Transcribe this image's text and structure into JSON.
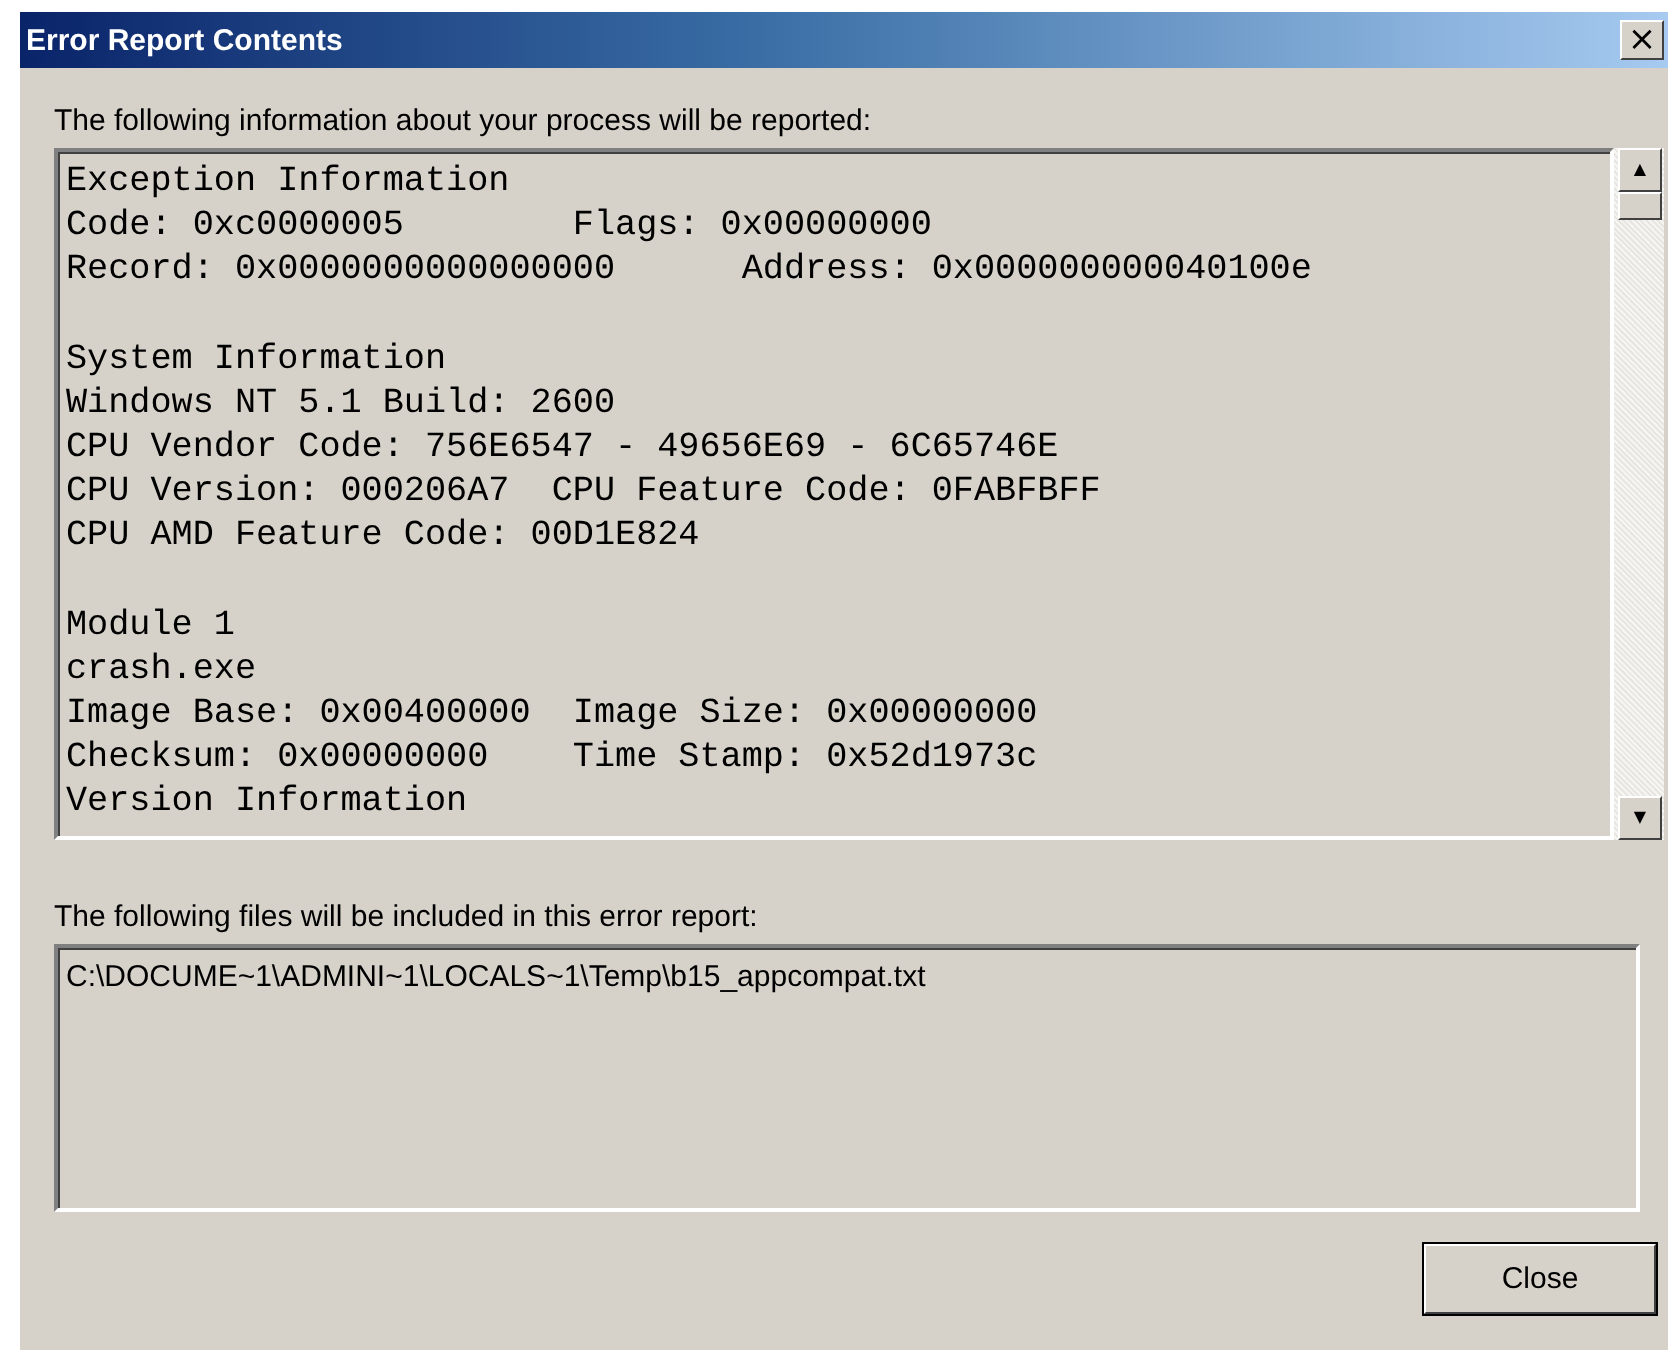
{
  "window": {
    "title": "Error Report Contents",
    "close": "×"
  },
  "report": {
    "label": "The following information about your process will be reported:",
    "sections": [
      {
        "lines": [
          "Exception Information",
          "Code: 0xc0000005        Flags: 0x00000000",
          "Record: 0x0000000000000000      Address: 0x000000000040100e"
        ]
      },
      {
        "lines": [
          "System Information",
          "Windows NT 5.1 Build: 2600",
          "CPU Vendor Code: 756E6547 - 49656E69 - 6C65746E",
          "CPU Version: 000206A7  CPU Feature Code: 0FABFBFF",
          "CPU AMD Feature Code: 00D1E824"
        ]
      },
      {
        "lines": [
          "Module 1",
          "crash.exe",
          "Image Base: 0x00400000  Image Size: 0x00000000",
          "Checksum: 0x00000000    Time Stamp: 0x52d1973c",
          "Version Information"
        ]
      }
    ],
    "scroll_up": "▲",
    "scroll_down": "▼"
  },
  "files": {
    "label": "The following files will be included in this error report:",
    "items": [
      "C:\\DOCUME~1\\ADMINI~1\\LOCALS~1\\Temp\\b15_appcompat.txt"
    ]
  },
  "buttons": [
    "Close"
  ]
}
